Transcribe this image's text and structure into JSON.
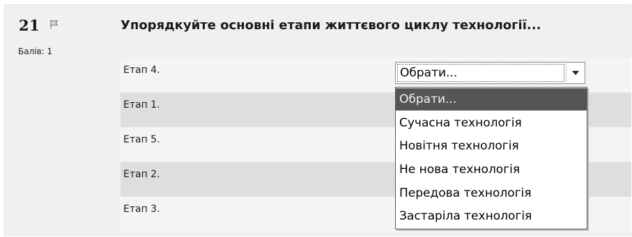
{
  "question": {
    "number": "21",
    "flag_icon": "flag-icon",
    "score_label": "Балів: 1",
    "text": "Упорядкуйте основні етапи життєвого циклу технології..."
  },
  "rows": [
    {
      "label": "Етап 4."
    },
    {
      "label": "Етап 1."
    },
    {
      "label": "Етап 5."
    },
    {
      "label": "Етап 2."
    },
    {
      "label": "Етап 3."
    }
  ],
  "select": {
    "value": "Обрати...",
    "options": [
      "Обрати...",
      "Сучасна технологія",
      "Новітня технологія",
      "Не нова технологія",
      "Передова технологія",
      "Застаріла технологія"
    ]
  },
  "colors": {
    "selected_option_bg": "#555555",
    "row_alt_bg": "#dedede",
    "row_bg": "#f4f4f4"
  }
}
